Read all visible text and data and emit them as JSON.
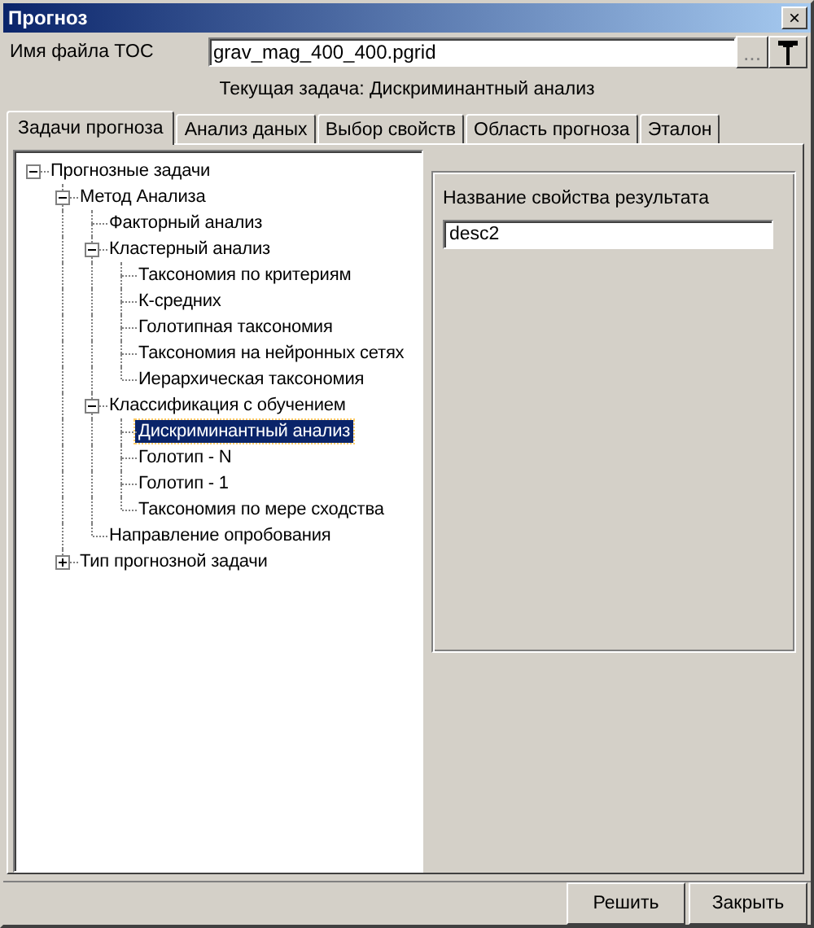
{
  "window": {
    "title": "Прогноз",
    "close": "×"
  },
  "file": {
    "label": "Имя файла TOC",
    "value": "grav_mag_400_400.pgrid",
    "browse": "..."
  },
  "current_task": "Текущая задача: Дискриминантный анализ",
  "tabs": [
    {
      "label": "Задачи прогноза",
      "selected": true
    },
    {
      "label": "Анализ даных",
      "selected": false
    },
    {
      "label": "Выбор свойств",
      "selected": false
    },
    {
      "label": "Область прогноза",
      "selected": false
    },
    {
      "label": "Эталон",
      "selected": false
    }
  ],
  "tree": [
    {
      "label": "Прогнозные задачи",
      "selected": false,
      "expanded": true,
      "children": [
        {
          "label": "Метод Анализа",
          "selected": false,
          "expanded": true,
          "children": [
            {
              "label": "Факторный анализ",
              "selected": false
            },
            {
              "label": "Кластерный анализ",
              "selected": false,
              "expanded": true,
              "children": [
                {
                  "label": "Таксономия по критериям",
                  "selected": false
                },
                {
                  "label": "К-средних",
                  "selected": false
                },
                {
                  "label": "Голотипная таксономия",
                  "selected": false
                },
                {
                  "label": "Таксономия на нейронных сетях",
                  "selected": false
                },
                {
                  "label": "Иерархическая таксономия",
                  "selected": false
                }
              ]
            },
            {
              "label": "Классификация с обучением",
              "selected": false,
              "expanded": true,
              "children": [
                {
                  "label": "Дискриминантный анализ",
                  "selected": true
                },
                {
                  "label": "Голотип - N",
                  "selected": false
                },
                {
                  "label": "Голотип - 1",
                  "selected": false
                },
                {
                  "label": "Таксономия по мере сходства",
                  "selected": false
                }
              ]
            },
            {
              "label": "Направление опробования",
              "selected": false
            }
          ]
        },
        {
          "label": "Тип прогнозной задачи",
          "selected": false,
          "expanded": false
        }
      ]
    }
  ],
  "result": {
    "label": "Название свойства результата",
    "value": "desc2"
  },
  "buttons": [
    "Решить",
    "Закрыть"
  ]
}
